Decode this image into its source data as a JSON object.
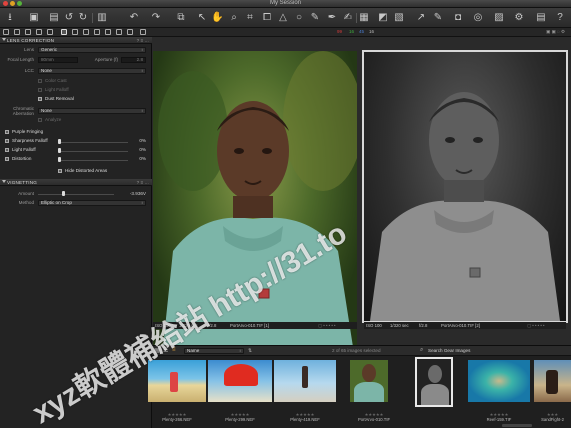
{
  "window": {
    "title": "My Session"
  },
  "viewer_header": {
    "rating_counts": [
      "99",
      "16",
      "45",
      "16"
    ],
    "right_icons": "▣ ▣ ◌ ⚙"
  },
  "sidebar": {
    "lens_correction": {
      "title": "LENS CORRECTION",
      "lens_label": "Lens",
      "lens_value": "Generic",
      "focal_label": "Focal Length",
      "focal_value": "80mm",
      "aperture_label": "Aperture (f)",
      "aperture_value": "2.8",
      "lcc_label": "LCC",
      "lcc_value": "None",
      "color_cast_label": "Color Cast",
      "light_falloff_label": "Light Falloff",
      "dust_removal_label": "Dust Removal",
      "chromatic_label": "Chromatic Aberration",
      "chromatic_value": "None",
      "analyze_label": "Analyze",
      "purple_fringing_label": "Purple Fringing",
      "sharpness_falloff_label": "Sharpness Falloff",
      "sharpness_falloff_value": "0%",
      "light_falloff2_label": "Light Falloff",
      "light_falloff2_value": "0%",
      "distortion_label": "Distortion",
      "distortion_value": "0%",
      "hide_distorted_label": "Hide Distorted Areas"
    },
    "vignetting": {
      "title": "VIGNETTING",
      "amount_label": "Amount",
      "amount_value": "-3.936V",
      "method_label": "Method",
      "method_value": "Elliptic on Crop"
    }
  },
  "viewer": {
    "left_photo": {
      "iso": "ISO 100",
      "shutter": "1/320 sec",
      "aperture": "f/2.8",
      "filename": "PortArvo-010.TIF [1]"
    },
    "right_photo": {
      "iso": "ISO 100",
      "shutter": "1/320 sec",
      "aperture": "f/2.8",
      "filename": "PortArvo-010.TIF [2]"
    }
  },
  "browser": {
    "sort_label": "Name",
    "selection_status": "2 of 65 images selected",
    "search_placeholder": "Search Gear Images",
    "thumbnails": [
      {
        "name": "Plenty-266.NEF",
        "stars": "★★★★★"
      },
      {
        "name": "Plenty-299.NEF",
        "stars": "★★★★★"
      },
      {
        "name": "Plenty-419.NEF",
        "stars": "★★★★★"
      },
      {
        "name": "PortArvo-010.TIF",
        "stars": "★★★★★"
      },
      {
        "name": "",
        "stars": ""
      },
      {
        "name": "Reef-159.TIF",
        "stars": "★★★★★"
      },
      {
        "name": "SandFight-2",
        "stars": "★★★"
      }
    ]
  },
  "watermark": {
    "text": "xyz軟體補給站 http://31.to"
  },
  "colors": {
    "accent_red": "#d23b3b",
    "accent_green": "#3fae3f",
    "accent_blue": "#4a7fd6",
    "selection": "#e8e8e8"
  }
}
